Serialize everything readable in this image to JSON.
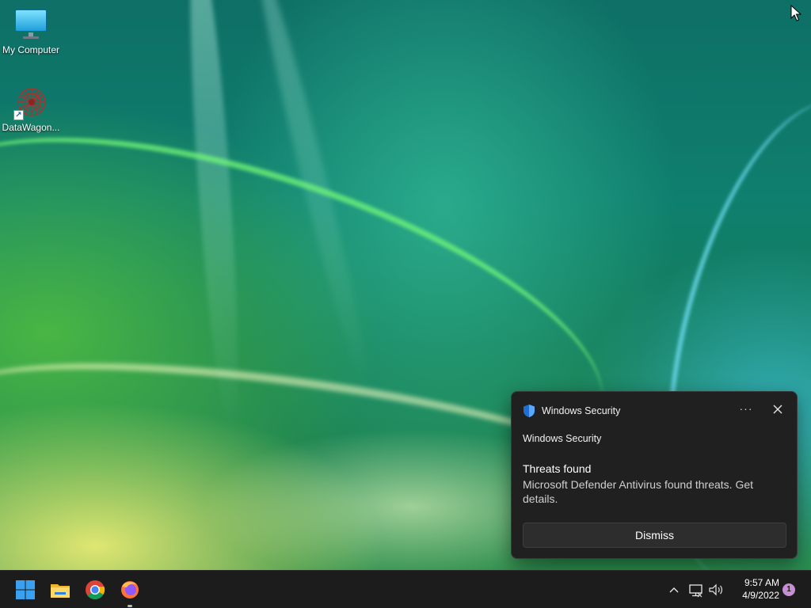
{
  "desktop": {
    "icons": [
      {
        "label": "My Computer",
        "icon": "computer-icon"
      },
      {
        "label": "DataWagon...",
        "icon": "datawagon-app-icon"
      }
    ]
  },
  "notification": {
    "app_name": "Windows Security",
    "app_icon": "shield-icon",
    "more_label": "···",
    "source": "Windows Security",
    "title": "Threats found",
    "body": "Microsoft Defender Antivirus found threats. Get details.",
    "dismiss_label": "Dismiss"
  },
  "taskbar": {
    "apps": [
      {
        "name": "Start",
        "icon": "windows-logo-icon"
      },
      {
        "name": "File Explorer",
        "icon": "folder-icon"
      },
      {
        "name": "Google Chrome",
        "icon": "chrome-icon"
      },
      {
        "name": "Firefox",
        "icon": "firefox-icon",
        "running": true
      }
    ],
    "tray": {
      "chevron_icon": "chevron-up-icon",
      "network_icon": "network-icon",
      "volume_icon": "volume-icon",
      "time": "9:57 AM",
      "date": "4/9/2022",
      "notification_count": "1"
    }
  },
  "colors": {
    "toast_bg": "#202020",
    "taskbar_bg": "#1c1c1c",
    "accent_shield": "#1f6fd1",
    "badge": "#c78fd3"
  }
}
